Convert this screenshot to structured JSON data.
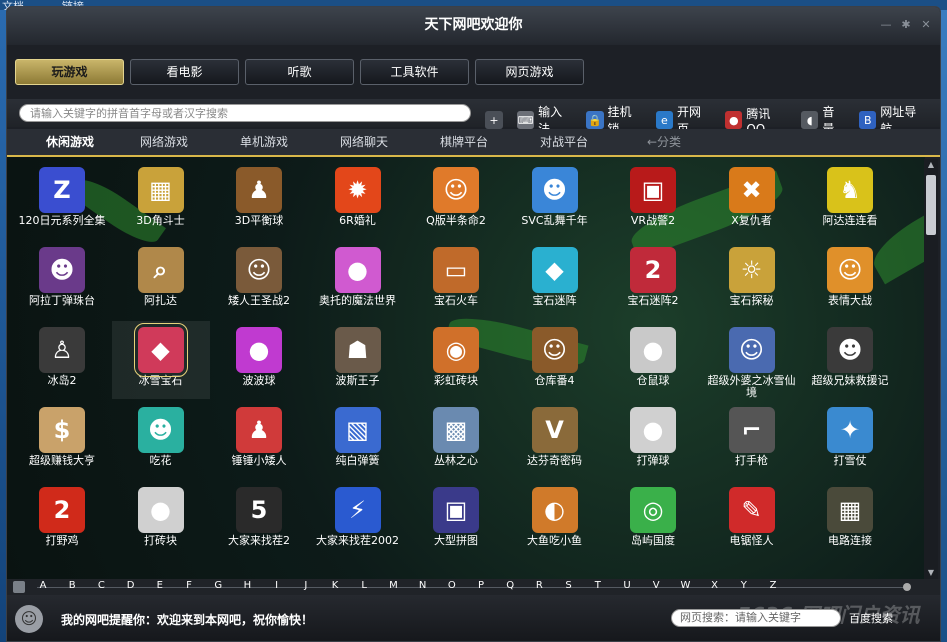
{
  "desktop": {
    "left_text": "文档",
    "right_text": "链接"
  },
  "window": {
    "title": "天下网吧欢迎你"
  },
  "category_tabs": [
    {
      "label": "玩游戏",
      "active": true
    },
    {
      "label": "看电影",
      "active": false
    },
    {
      "label": "听歌",
      "active": false
    },
    {
      "label": "工具软件",
      "active": false
    },
    {
      "label": "网页游戏",
      "active": false
    }
  ],
  "toolbar": {
    "search_placeholder": "请输入关键字的拼音首字母或者汉字搜索",
    "tools": [
      {
        "label": "",
        "icon": "plus-icon",
        "color": "#4a4f57"
      },
      {
        "label": "输入法",
        "icon": "keyboard-icon",
        "color": "#6c7078"
      },
      {
        "label": "挂机锁",
        "icon": "lock-icon",
        "color": "#3a74c4"
      },
      {
        "label": "开网页",
        "icon": "globe-icon",
        "color": "#2a79c8"
      },
      {
        "label": "腾讯QQ",
        "icon": "penguin-icon",
        "color": "#c03030"
      },
      {
        "label": "音量",
        "icon": "speaker-icon",
        "color": "#555a61"
      },
      {
        "label": "网址导航",
        "icon": "baidu-icon",
        "color": "#2f62c0"
      }
    ]
  },
  "sub_tabs": [
    {
      "label": "休闲游戏",
      "state": "active"
    },
    {
      "label": "网络游戏",
      "state": "normal"
    },
    {
      "label": "单机游戏",
      "state": "normal"
    },
    {
      "label": "网络聊天",
      "state": "normal"
    },
    {
      "label": "棋牌平台",
      "state": "normal"
    },
    {
      "label": "对战平台",
      "state": "normal"
    },
    {
      "label": "←分类",
      "state": "inactive"
    }
  ],
  "games": [
    {
      "name": "120日元系列全集",
      "glyph": "Z",
      "color": "#3a4ed0"
    },
    {
      "name": "3D角斗士",
      "glyph": "▦",
      "color": "#c9a23a"
    },
    {
      "name": "3D平衡球",
      "glyph": "♟",
      "color": "#8a5a2a"
    },
    {
      "name": "6R婚礼",
      "glyph": "✹",
      "color": "#e3471a"
    },
    {
      "name": "Q版半条命2",
      "glyph": "☺",
      "color": "#e07a2a"
    },
    {
      "name": "SVC乱舞千年",
      "glyph": "☻",
      "color": "#3a86d8"
    },
    {
      "name": "VR战警2",
      "glyph": "▣",
      "color": "#b81a1a"
    },
    {
      "name": "X复仇者",
      "glyph": "✖",
      "color": "#d97a1a"
    },
    {
      "name": "阿达连连看",
      "glyph": "♞",
      "color": "#d9c21a"
    },
    {
      "name": "阿拉丁弹珠台",
      "glyph": "☻",
      "color": "#6a3a8a"
    },
    {
      "name": "阿扎达",
      "glyph": "⌕",
      "color": "#b0884a"
    },
    {
      "name": "矮人王圣战2",
      "glyph": "☺",
      "color": "#7a5a3a"
    },
    {
      "name": "奥托的魔法世界",
      "glyph": "●",
      "color": "#d05ad0"
    },
    {
      "name": "宝石火车",
      "glyph": "▭",
      "color": "#c06a2a"
    },
    {
      "name": "宝石迷阵",
      "glyph": "◆",
      "color": "#2ab0d0"
    },
    {
      "name": "宝石迷阵2",
      "glyph": "2",
      "color": "#c02a3a"
    },
    {
      "name": "宝石探秘",
      "glyph": "☼",
      "color": "#c9a23a"
    },
    {
      "name": "表情大战",
      "glyph": "☺",
      "color": "#e0902a"
    },
    {
      "name": "冰岛2",
      "glyph": "♙",
      "color": "#3a3a3a"
    },
    {
      "name": "冰雪宝石",
      "glyph": "◆",
      "color": "#d03a5a"
    },
    {
      "name": "波波球",
      "glyph": "●",
      "color": "#c03ad0"
    },
    {
      "name": "波斯王子",
      "glyph": "☗",
      "color": "#6a5a4a"
    },
    {
      "name": "彩虹砖块",
      "glyph": "◉",
      "color": "#d0702a"
    },
    {
      "name": "仓库番4",
      "glyph": "☺",
      "color": "#8a5a2a"
    },
    {
      "name": "仓鼠球",
      "glyph": "●",
      "color": "#c9c9c9"
    },
    {
      "name": "超级外婆之冰雪仙境",
      "glyph": "☺",
      "color": "#4a6ab0"
    },
    {
      "name": "超级兄妹救援记",
      "glyph": "☻",
      "color": "#3a3a3a"
    },
    {
      "name": "超级赚钱大亨",
      "glyph": "$",
      "color": "#c9a26a"
    },
    {
      "name": "吃花",
      "glyph": "☻",
      "color": "#2ab0a0"
    },
    {
      "name": "锤锤小矮人",
      "glyph": "♟",
      "color": "#d03a3a"
    },
    {
      "name": "纯白弹簧",
      "glyph": "▧",
      "color": "#3a6ad0"
    },
    {
      "name": "丛林之心",
      "glyph": "▩",
      "color": "#6a8ab0"
    },
    {
      "name": "达芬奇密码",
      "glyph": "V",
      "color": "#8a6a3a"
    },
    {
      "name": "打弹球",
      "glyph": "●",
      "color": "#d0d0d0"
    },
    {
      "name": "打手枪",
      "glyph": "⌐",
      "color": "#555555"
    },
    {
      "name": "打雪仗",
      "glyph": "✦",
      "color": "#3a8ad0"
    },
    {
      "name": "打野鸡",
      "glyph": "2",
      "color": "#d02a1a"
    },
    {
      "name": "打砖块",
      "glyph": "●",
      "color": "#d0d0d0"
    },
    {
      "name": "大家来找茬2",
      "glyph": "5",
      "color": "#2a2a2a"
    },
    {
      "name": "大家来找茬2002",
      "glyph": "⚡",
      "color": "#2a5ad0"
    },
    {
      "name": "大型拼图",
      "glyph": "▣",
      "color": "#3a3a8a"
    },
    {
      "name": "大鱼吃小鱼",
      "glyph": "◐",
      "color": "#d07a2a"
    },
    {
      "name": "岛屿国度",
      "glyph": "◎",
      "color": "#3ab04a"
    },
    {
      "name": "电锯怪人",
      "glyph": "✎",
      "color": "#d02a2a"
    },
    {
      "name": "电路连接",
      "glyph": "▦",
      "color": "#4a4a3a"
    }
  ],
  "alphabet": [
    "A",
    "B",
    "C",
    "D",
    "E",
    "F",
    "G",
    "H",
    "I",
    "J",
    "K",
    "L",
    "M",
    "N",
    "O",
    "P",
    "Q",
    "R",
    "S",
    "T",
    "U",
    "V",
    "W",
    "X",
    "Y",
    "Z"
  ],
  "status": {
    "notice": "我的网吧提醒你：欢迎来到本网吧，祝你愉快！",
    "web_search_placeholder": "网页搜索：请输入关键字",
    "baidu_label": "百度搜索",
    "watermark": "5636 网吧门户资讯"
  }
}
